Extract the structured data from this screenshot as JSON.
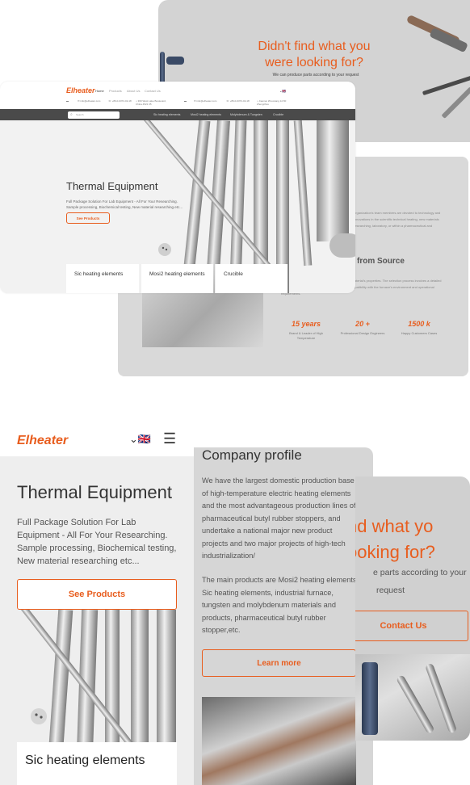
{
  "colors": {
    "accent": "#e85d1e",
    "dark_bar": "#4a4a4a",
    "card_gray": "#d6d6d6"
  },
  "desktop_didnt_find": {
    "title": "Didn't find what you were looking for?",
    "subtitle": "We can produce parts according to your request"
  },
  "desktop_company": {
    "para1": "organization's team members are devoted to technology and innovations in the scientific technical heating, new materials researching, laboratory, or within a pharmaceutical and",
    "heading": "from Source",
    "para2": "one that is carefully chosen. This is based on the material's properties. The selection process involves a detailed analysis of the material properties, design, and compatibility with the furnace's environment and operational requirements.",
    "stats": [
      {
        "number": "15",
        "suffix": " years",
        "label": "Brand & Leader of High Temperature"
      },
      {
        "number": "20",
        "suffix": " +",
        "label": "Professional Design Engineers"
      },
      {
        "number": "1500",
        "suffix": " k",
        "label": "Happy Customers Cases"
      }
    ]
  },
  "desktop_home": {
    "logo": "Elheater",
    "nav": [
      "Home",
      "Products",
      "About Us",
      "Contact Us"
    ],
    "contacts": {
      "email1": "info@elheater.com",
      "phone1": "+86-0-0372-02-18",
      "address1": "360 West Lake Boulevard, China 4521 35",
      "email2": "info@elheater.com",
      "phone2": "+86-0-0372-02-18",
      "address2": "Jiaomei Zhouxiang 12-50 Zhengzhou"
    },
    "search_placeholder": "Search",
    "categories": [
      "Sic heating elements",
      "Mosi2 heating elements",
      "Molybdenum & Tungsten",
      "Crucible"
    ],
    "hero_title": "Thermal Equipment",
    "hero_desc": "Full Package Solution For Lab Equipment - All For Your Researching. Sample processing, Biochemical testing, New material researching etc...",
    "hero_button": "See Products",
    "tiles": [
      "Sic heating elements",
      "Mosi2 heating elements",
      "Crucible"
    ]
  },
  "mobile_home": {
    "logo": "Elheater",
    "hero_title": "Thermal Equipment",
    "hero_desc": "Full Package Solution For Lab Equipment - All For Your Researching. Sample processing, Biochemical testing, New material researching etc...",
    "hero_button": "See Products",
    "tile": "Sic heating elements"
  },
  "company_profile": {
    "title": "Company profile",
    "para1": "We have the largest domestic production base of high-temperature electric heating elements and the most advantageous production lines of pharmaceutical butyl rubber stoppers, and undertake a national major new product projects and two major projects of high-tech industrialization/",
    "para2": "The main products are Mosi2 heating elements, Sic heating elements, industrial furnace, tungsten and molybdenum materials and products, pharmaceutical butyl rubber stopper,etc.",
    "button": "Learn more"
  },
  "mobile_didnt_find": {
    "title_line1": "nd what yo",
    "title_line2": "ooking for?",
    "sub_line1": "e parts according to your",
    "sub_line2": "request",
    "button": "Contact Us"
  }
}
